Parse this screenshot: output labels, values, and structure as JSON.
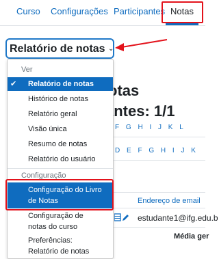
{
  "topnav": {
    "items": [
      {
        "label": "Curso"
      },
      {
        "label": "Configurações"
      },
      {
        "label": "Participantes"
      },
      {
        "label": "Notas"
      }
    ]
  },
  "selector": {
    "label": "Relatório de notas",
    "chevron": "⌄"
  },
  "dropdown": {
    "group_view": "Ver",
    "view_items": [
      {
        "label": "Relatório de notas",
        "active": true
      },
      {
        "label": "Histórico de notas"
      },
      {
        "label": "Relatório geral"
      },
      {
        "label": "Visão única"
      },
      {
        "label": "Resumo de notas"
      },
      {
        "label": "Relatório do usuário"
      }
    ],
    "group_config": "Configuração",
    "config_items": [
      {
        "label_line1": "Configuração do Livro",
        "label_line2": "de Notas",
        "active": true
      },
      {
        "label_line1": "Configuração de",
        "label_line2": "notas do curso"
      },
      {
        "label_line1": "Preferências:",
        "label_line2": "Relatório de notas"
      }
    ]
  },
  "background": {
    "heading1": "otas",
    "heading2": "antes: 1/1",
    "letters_row1": "F G H I J K L",
    "letters_row2": "D E F G H I J K",
    "email_header": "Endereço de email",
    "email_value": "estudante1@ifg.edu.b",
    "media_geral": "Média ger"
  },
  "colors": {
    "accent": "#0f6cbf",
    "highlight_box": "#e3121b"
  }
}
